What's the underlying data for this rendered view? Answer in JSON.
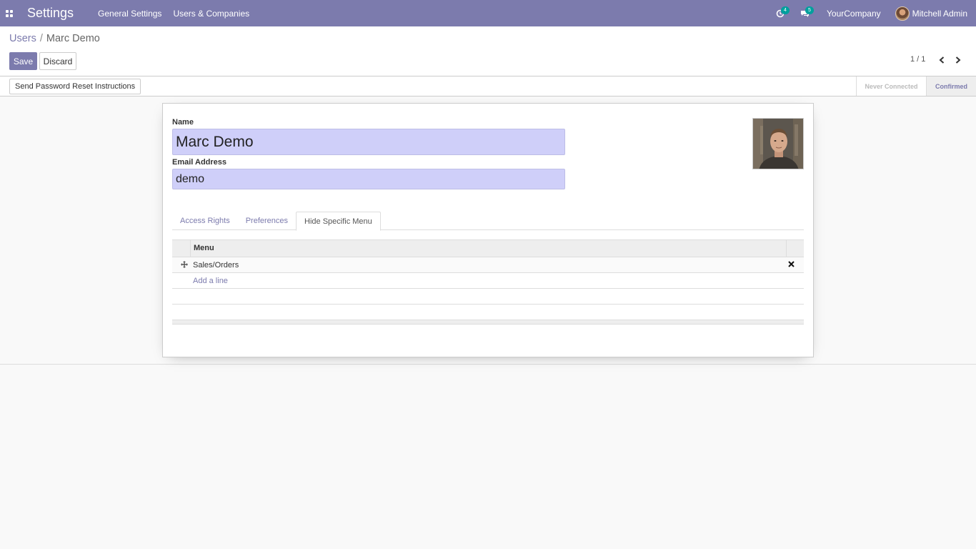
{
  "navbar": {
    "app_title": "Settings",
    "menus": [
      "General Settings",
      "Users & Companies"
    ],
    "activity_count": "4",
    "message_count": "5",
    "company": "YourCompany",
    "user": "Mitchell Admin"
  },
  "breadcrumb": {
    "parent": "Users",
    "separator": "/",
    "current": "Marc Demo"
  },
  "buttons": {
    "save": "Save",
    "discard": "Discard",
    "reset_password": "Send Password Reset Instructions"
  },
  "pager": {
    "value": "1 / 1"
  },
  "status": {
    "stages": [
      "Never Connected",
      "Confirmed"
    ],
    "active": "Confirmed"
  },
  "form": {
    "name_label": "Name",
    "name_value": "Marc Demo",
    "email_label": "Email Address",
    "email_value": "demo"
  },
  "tabs": [
    {
      "label": "Access Rights"
    },
    {
      "label": "Preferences"
    },
    {
      "label": "Hide Specific Menu"
    }
  ],
  "active_tab": "Hide Specific Menu",
  "table": {
    "header_menu": "Menu",
    "rows": [
      {
        "menu": "Sales/Orders"
      }
    ],
    "add_line": "Add a line"
  },
  "colors": {
    "brand": "#7c7bad",
    "badge": "#00a09d",
    "input_bg": "#cfcff9"
  }
}
